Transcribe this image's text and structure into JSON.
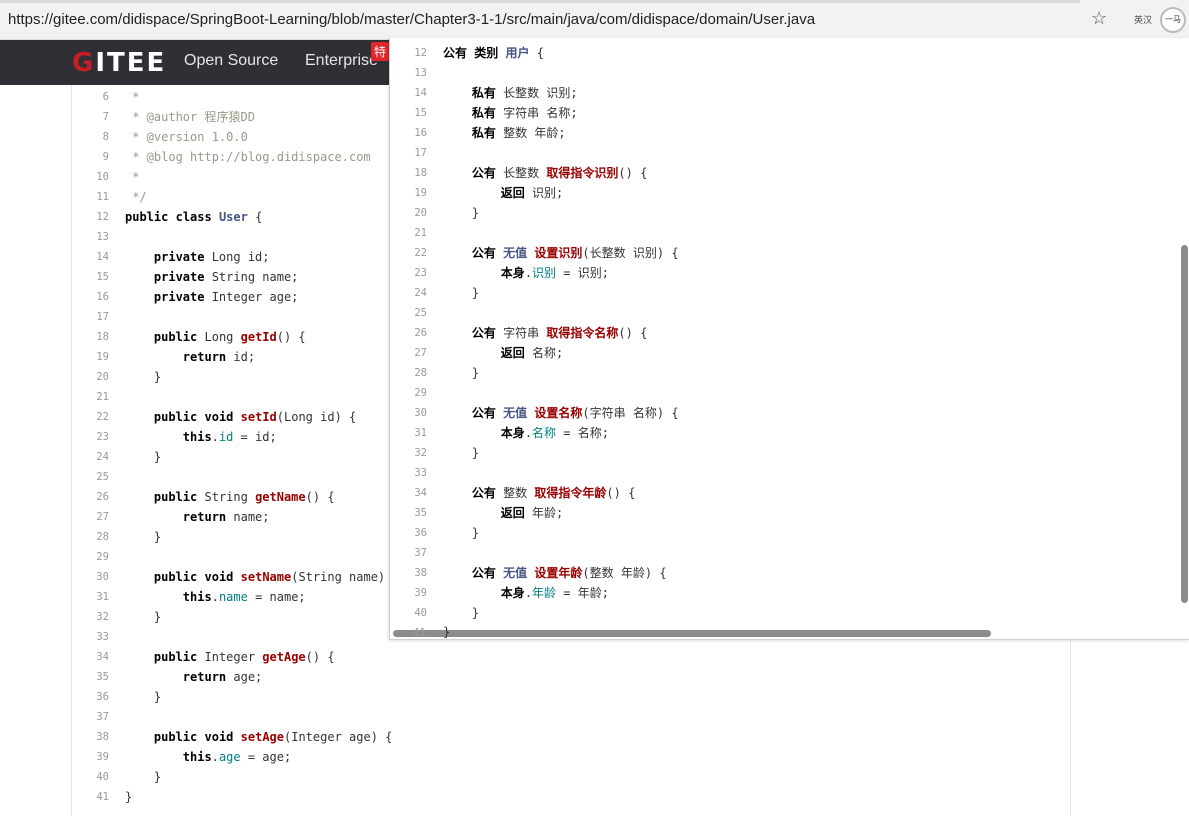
{
  "browser": {
    "url": "https://gitee.com/didispace/SpringBoot-Learning/blob/master/Chapter3-1-1/src/main/java/com/didispace/domain/User.java",
    "star_icon": "star-icon",
    "translate_label": "英汉",
    "profile_label": "一马"
  },
  "header": {
    "logo": "GITEE",
    "nav": [
      "Open Source",
      "Enterprise"
    ],
    "badge": "特"
  },
  "code_lines": [
    {
      "n": "6",
      "t": " *"
    },
    {
      "n": "7",
      "t": " * @author 程序猿DD"
    },
    {
      "n": "8",
      "t": " * @version 1.0.0"
    },
    {
      "n": "9",
      "t": " * @blog http://blog.didispace.com"
    },
    {
      "n": "10",
      "t": " *"
    },
    {
      "n": "11",
      "t": " */"
    },
    {
      "n": "12",
      "t": "public class User {"
    },
    {
      "n": "13",
      "t": ""
    },
    {
      "n": "14",
      "t": "    private Long id;"
    },
    {
      "n": "15",
      "t": "    private String name;"
    },
    {
      "n": "16",
      "t": "    private Integer age;"
    },
    {
      "n": "17",
      "t": ""
    },
    {
      "n": "18",
      "t": "    public Long getId() {"
    },
    {
      "n": "19",
      "t": "        return id;"
    },
    {
      "n": "20",
      "t": "    }"
    },
    {
      "n": "21",
      "t": ""
    },
    {
      "n": "22",
      "t": "    public void setId(Long id) {"
    },
    {
      "n": "23",
      "t": "        this.id = id;"
    },
    {
      "n": "24",
      "t": "    }"
    },
    {
      "n": "25",
      "t": ""
    },
    {
      "n": "26",
      "t": "    public String getName() {"
    },
    {
      "n": "27",
      "t": "        return name;"
    },
    {
      "n": "28",
      "t": "    }"
    },
    {
      "n": "29",
      "t": ""
    },
    {
      "n": "30",
      "t": "    public void setName(String name) {"
    },
    {
      "n": "31",
      "t": "        this.name = name;"
    },
    {
      "n": "32",
      "t": "    }"
    },
    {
      "n": "33",
      "t": ""
    },
    {
      "n": "34",
      "t": "    public Integer getAge() {"
    },
    {
      "n": "35",
      "t": "        return age;"
    },
    {
      "n": "36",
      "t": "    }"
    },
    {
      "n": "37",
      "t": ""
    },
    {
      "n": "38",
      "t": "    public void setAge(Integer age) {"
    },
    {
      "n": "39",
      "t": "        this.age = age;"
    },
    {
      "n": "40",
      "t": "    }"
    },
    {
      "n": "41",
      "t": "}"
    }
  ],
  "translated_lines": [
    {
      "n": "12",
      "t": "公有 类别 用户 {"
    },
    {
      "n": "13",
      "t": ""
    },
    {
      "n": "14",
      "t": "    私有 长整数 识别;"
    },
    {
      "n": "15",
      "t": "    私有 字符串 名称;"
    },
    {
      "n": "16",
      "t": "    私有 整数 年龄;"
    },
    {
      "n": "17",
      "t": ""
    },
    {
      "n": "18",
      "t": "    公有 长整数 取得指令识别() {"
    },
    {
      "n": "19",
      "t": "        返回 识别;"
    },
    {
      "n": "20",
      "t": "    }"
    },
    {
      "n": "21",
      "t": ""
    },
    {
      "n": "22",
      "t": "    公有 无值 设置识别(长整数 识别) {"
    },
    {
      "n": "23",
      "t": "        本身.识别 = 识别;"
    },
    {
      "n": "24",
      "t": "    }"
    },
    {
      "n": "25",
      "t": ""
    },
    {
      "n": "26",
      "t": "    公有 字符串 取得指令名称() {"
    },
    {
      "n": "27",
      "t": "        返回 名称;"
    },
    {
      "n": "28",
      "t": "    }"
    },
    {
      "n": "29",
      "t": ""
    },
    {
      "n": "30",
      "t": "    公有 无值 设置名称(字符串 名称) {"
    },
    {
      "n": "31",
      "t": "        本身.名称 = 名称;"
    },
    {
      "n": "32",
      "t": "    }"
    },
    {
      "n": "33",
      "t": ""
    },
    {
      "n": "34",
      "t": "    公有 整数 取得指令年龄() {"
    },
    {
      "n": "35",
      "t": "        返回 年龄;"
    },
    {
      "n": "36",
      "t": "    }"
    },
    {
      "n": "37",
      "t": ""
    },
    {
      "n": "38",
      "t": "    公有 无值 设置年龄(整数 年龄) {"
    },
    {
      "n": "39",
      "t": "        本身.年龄 = 年龄;"
    },
    {
      "n": "40",
      "t": "    }"
    }
  ],
  "translated_last": {
    "n": "41",
    "t": "}"
  }
}
